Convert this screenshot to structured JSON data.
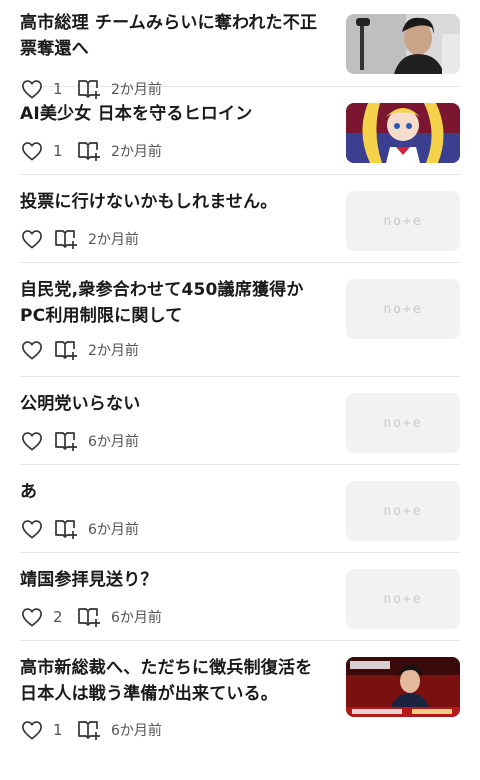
{
  "articles": [
    {
      "title": "高市総理 チームみらいに奪われた不正票奪還へ",
      "likes": "1",
      "date": "2か月前",
      "thumb": "photo-man-microphone"
    },
    {
      "title": "AI美少女 日本を守るヒロイン",
      "likes": "1",
      "date": "2か月前",
      "thumb": "anime-heroine-illustration"
    },
    {
      "title": "投票に行けないかもしれません。",
      "likes": "",
      "date": "2か月前",
      "thumb": "note-placeholder",
      "logo": "no+e"
    },
    {
      "title": "自民党,衆参合わせて450議席獲得か PC利用制限に関して",
      "likes": "",
      "date": "2か月前",
      "thumb": "note-placeholder",
      "logo": "no+e"
    },
    {
      "title": "公明党いらない",
      "likes": "",
      "date": "6か月前",
      "thumb": "note-placeholder",
      "logo": "no+e"
    },
    {
      "title": "あ",
      "likes": "",
      "date": "6か月前",
      "thumb": "note-placeholder",
      "logo": "no+e"
    },
    {
      "title": "靖国参拝見送り？",
      "likes": "2",
      "date": "6か月前",
      "thumb": "note-placeholder",
      "logo": "no+e"
    },
    {
      "title": "高市新総裁へ、ただちに徴兵制復活を 日本人は戦う準備が出来ている。",
      "likes": "1",
      "date": "6か月前",
      "thumb": "news-broadcast-photo"
    }
  ],
  "icons": {
    "like": "heart-icon",
    "magazine": "add-to-magazine-icon"
  },
  "colors": {
    "title": "#1a1a1a",
    "meta": "#555555",
    "divider": "#e6e6e6",
    "placeholder": "#f2f2f2"
  }
}
